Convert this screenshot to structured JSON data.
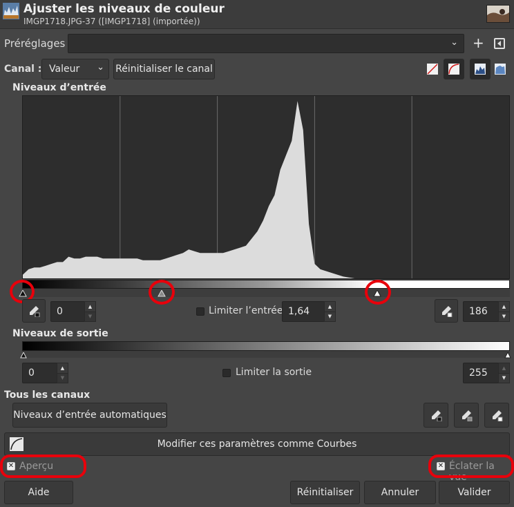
{
  "window": {
    "title": "Ajuster les niveaux de couleur",
    "subtitle": "IMGP1718.JPG-37 ([IMGP1718] (importée))"
  },
  "presets": {
    "label": "Préréglages :",
    "value": ""
  },
  "channel": {
    "label": "Canal :",
    "value": "Valeur",
    "reset_button": "Réinitialiser le canal"
  },
  "input_levels": {
    "section_title": "Niveaux d’entrée",
    "low": "0",
    "gamma": "1,64",
    "high": "186",
    "clamp_label": "Limiter l’entrée"
  },
  "output_levels": {
    "section_title": "Niveaux de sortie",
    "low": "0",
    "high": "255",
    "clamp_label": "Limiter la sortie"
  },
  "all_channels": {
    "section_title": "Tous les canaux",
    "auto_button": "Niveaux d’entrée automatiques",
    "curves_button": "Modifier ces paramètres comme Courbes"
  },
  "options": {
    "preview_label": "Aperçu",
    "split_label": "Éclater la vue"
  },
  "buttons": {
    "help": "Aide",
    "reset": "Réinitialiser",
    "cancel": "Annuler",
    "ok": "Valider"
  },
  "colors": {
    "background": "#454545",
    "histogram_fill": "#dcdcdc",
    "highlight": "#e8000b"
  },
  "chart_data": {
    "type": "area",
    "xlim": [
      0,
      255
    ],
    "ylim": [
      0,
      1
    ],
    "x": [
      0,
      3,
      6,
      9,
      12,
      15,
      18,
      21,
      24,
      27,
      30,
      33,
      36,
      39,
      42,
      45,
      48,
      51,
      54,
      57,
      60,
      63,
      66,
      69,
      72,
      75,
      78,
      81,
      84,
      87,
      90,
      93,
      96,
      99,
      102,
      105,
      108,
      111,
      114,
      117,
      120,
      123,
      126,
      129,
      132,
      135,
      138,
      141,
      144,
      147,
      150,
      153,
      156,
      159,
      162,
      165,
      168,
      171,
      174,
      177,
      180,
      183,
      186,
      189,
      192,
      195,
      198,
      201,
      204,
      207,
      210,
      213,
      216,
      219,
      222,
      225,
      228,
      231,
      234,
      237,
      240,
      243,
      246,
      249,
      252,
      255
    ],
    "values": [
      0.02,
      0.05,
      0.06,
      0.06,
      0.07,
      0.08,
      0.09,
      0.09,
      0.12,
      0.11,
      0.11,
      0.12,
      0.12,
      0.12,
      0.11,
      0.11,
      0.11,
      0.11,
      0.11,
      0.11,
      0.11,
      0.1,
      0.1,
      0.1,
      0.1,
      0.11,
      0.12,
      0.13,
      0.14,
      0.16,
      0.15,
      0.14,
      0.14,
      0.14,
      0.14,
      0.14,
      0.15,
      0.16,
      0.17,
      0.18,
      0.22,
      0.26,
      0.32,
      0.4,
      0.46,
      0.6,
      0.68,
      0.76,
      0.98,
      0.82,
      0.3,
      0.08,
      0.05,
      0.04,
      0.03,
      0.02,
      0.01,
      0.005,
      0,
      0,
      0,
      0,
      0,
      0,
      0,
      0,
      0,
      0,
      0,
      0,
      0,
      0,
      0,
      0,
      0,
      0,
      0,
      0,
      0,
      0,
      0,
      0,
      0,
      0,
      0,
      0
    ]
  }
}
